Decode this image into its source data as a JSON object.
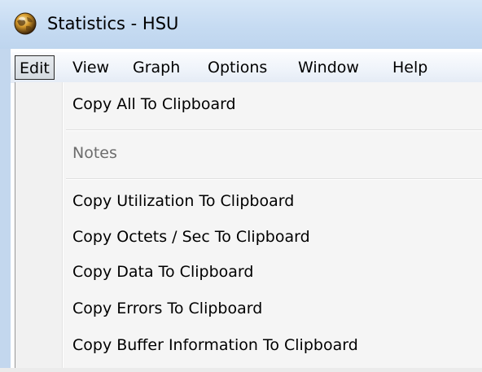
{
  "window": {
    "title": "Statistics - HSU",
    "icon": "globe-icon"
  },
  "menubar": {
    "items": [
      {
        "label": "Edit",
        "active": true
      },
      {
        "label": "View",
        "active": false
      },
      {
        "label": "Graph",
        "active": false
      },
      {
        "label": "Options",
        "active": false
      },
      {
        "label": "Window",
        "active": false
      },
      {
        "label": "Help",
        "active": false
      }
    ]
  },
  "edit_menu": {
    "items": [
      {
        "label": "Copy All To Clipboard",
        "enabled": true
      },
      {
        "label": "Notes",
        "enabled": false
      },
      {
        "label": "Copy Utilization To Clipboard",
        "enabled": true
      },
      {
        "label": "Copy Octets / Sec To Clipboard",
        "enabled": true
      },
      {
        "label": "Copy Data To Clipboard",
        "enabled": true
      },
      {
        "label": "Copy Errors To Clipboard",
        "enabled": true
      },
      {
        "label": "Copy Buffer Information To Clipboard",
        "enabled": true
      }
    ]
  },
  "colors": {
    "titlebar": "#c6dbf2",
    "menu_background": "#f5f5f5",
    "disabled_text": "#6d6d6d"
  }
}
